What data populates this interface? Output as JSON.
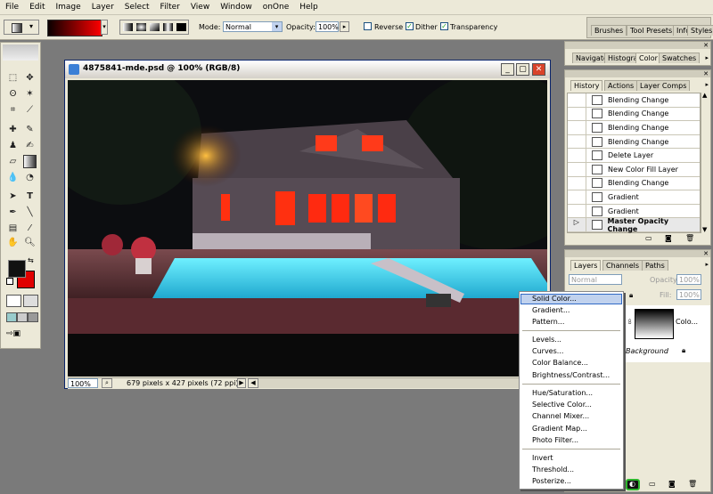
{
  "menubar": {
    "items": [
      "File",
      "Edit",
      "Image",
      "Layer",
      "Select",
      "Filter",
      "View",
      "Window",
      "onOne",
      "Help"
    ]
  },
  "options": {
    "mode_label": "Mode:",
    "mode_value": "Normal",
    "opacity_label": "Opacity:",
    "opacity_value": "100%",
    "reverse_label": "Reverse",
    "dither_label": "Dither",
    "transparency_label": "Transparency",
    "gradient_colors": [
      "#0a0000",
      "#ff0000"
    ]
  },
  "top_tabs": [
    "Brushes",
    "Tool Presets",
    "Info",
    "Styles"
  ],
  "document": {
    "title": "4875841-mde.psd @ 100% (RGB/8)",
    "zoom": "100%",
    "status": "679 pixels x 427 pixels (72 ppi)"
  },
  "navigator_tabs": [
    "Navigator",
    "Histogram",
    "Color",
    "Swatches"
  ],
  "history": {
    "tabs": [
      "History",
      "Actions",
      "Layer Comps"
    ],
    "items": [
      "Blending Change",
      "Blending Change",
      "Blending Change",
      "Blending Change",
      "Delete Layer",
      "New Color Fill Layer",
      "Blending Change",
      "Gradient",
      "Gradient",
      "Master Opacity Change"
    ]
  },
  "layers": {
    "tabs": [
      "Layers",
      "Channels",
      "Paths"
    ],
    "blend_mode": "Normal",
    "opacity_label": "Opacity:",
    "opacity_value": "100%",
    "fill_label": "Fill:",
    "fill_value": "100%",
    "layer1_name": "Colo...",
    "background_name": "Background"
  },
  "context_menu": {
    "group1": [
      "Solid Color...",
      "Gradient...",
      "Pattern..."
    ],
    "group2": [
      "Levels...",
      "Curves...",
      "Color Balance...",
      "Brightness/Contrast..."
    ],
    "group3": [
      "Hue/Saturation...",
      "Selective Color...",
      "Channel Mixer...",
      "Gradient Map...",
      "Photo Filter..."
    ],
    "group4": [
      "Invert",
      "Threshold...",
      "Posterize..."
    ]
  },
  "colors": {
    "foreground": "#111111",
    "background": "#e00000",
    "title_accent": "#0a246a",
    "highlight_green": "#2db52d"
  }
}
